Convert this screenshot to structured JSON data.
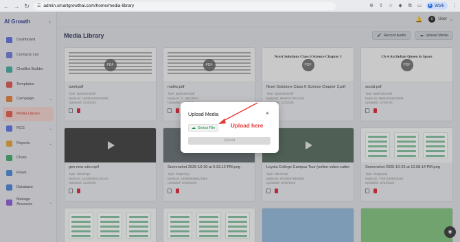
{
  "browser": {
    "url": "admin.smartgrowthai.com/home/media-library",
    "profile_label": "Work",
    "profile_initial": "D"
  },
  "sidebar": {
    "brand": "AI Growth",
    "items": [
      {
        "label": "Dashboard",
        "icon": "dashboard-icon",
        "color": "#5b6ee1"
      },
      {
        "label": "Contacts List",
        "icon": "contacts-icon",
        "color": "#6a7bd6"
      },
      {
        "label": "ChatBot Builder",
        "icon": "chatbot-icon",
        "color": "#3fa7a0"
      },
      {
        "label": "Templates",
        "icon": "templates-icon",
        "color": "#d9534f"
      },
      {
        "label": "Campaign",
        "icon": "campaign-icon",
        "color": "#e07b39",
        "caret": "⌄"
      },
      {
        "label": "Media Library",
        "icon": "media-icon",
        "color": "#e05a4a",
        "active": true
      },
      {
        "label": "RCS",
        "icon": "rcs-icon",
        "color": "#5b6ee1",
        "caret": "⌄"
      },
      {
        "label": "Reports",
        "icon": "reports-icon",
        "color": "#e0a23a",
        "caret": "⌄"
      },
      {
        "label": "Chats",
        "icon": "chats-icon",
        "color": "#3fa76a"
      },
      {
        "label": "Flows",
        "icon": "flows-icon",
        "color": "#4a86d6"
      },
      {
        "label": "Database",
        "icon": "database-icon",
        "color": "#4a7fd6"
      },
      {
        "label": "Manage Accounts",
        "icon": "accounts-icon",
        "color": "#8a5bd6",
        "caret": "⌄"
      }
    ]
  },
  "topbar": {
    "user_label": "User",
    "user_initial": "U"
  },
  "page": {
    "title": "Media Library",
    "record_audio": "Record Audio",
    "upload_media": "Upload Media"
  },
  "labels": {
    "type": "Type:",
    "media_id": "Media ID:",
    "uploaded": "Uploaded:"
  },
  "cards": [
    {
      "name": "tamil.pdf",
      "type": "application/pdf",
      "media_id": "1180826485404089",
      "uploaded": "11/3/2025",
      "kind": "doc",
      "heading": ""
    },
    {
      "name": "maths.pdf",
      "type": "application/pdf",
      "media_id": "2…68749701",
      "uploaded": "11/3/2025",
      "kind": "doc",
      "heading": ""
    },
    {
      "name": "Ncert Solutions Class 6 Science Chapter 3.pdf",
      "type": "application/pdf",
      "media_id": "889904270012644",
      "uploaded": "11/3/2025",
      "kind": "doc",
      "heading": "Ncert Solutions Class 6 Science Chapter 3"
    },
    {
      "name": "social.pdf",
      "type": "application/pdf",
      "media_id": "868945489430809",
      "uploaded": "11/3/2025",
      "kind": "doc",
      "heading": "Ch 4 An Indian Queen in Space"
    },
    {
      "name": "gen new vdo.mp4",
      "type": "video/mp4",
      "media_id": "1143309000122441",
      "uploaded": "11/3/2025",
      "kind": "video",
      "variant": "v1"
    },
    {
      "name": "Screenshot 2025-10-30 at 5.33.12 PM.png",
      "type": "image/png",
      "media_id": "1559958896537569",
      "uploaded": "10/30/2025",
      "kind": "video",
      "variant": "v2"
    },
    {
      "name": "Loyola College Campus Tour (online-video-cutter.co…",
      "type": "video/mp4",
      "media_id": "676382978405963",
      "uploaded": "10/30/2025",
      "kind": "video",
      "variant": "v3"
    },
    {
      "name": "Screenshot 2025-10-23 at 12.58.14 PM.png",
      "type": "image/png",
      "media_id": "776671898422063",
      "uploaded": "10/23/2025",
      "kind": "shot"
    }
  ],
  "row3": [
    {
      "kind": "shot"
    },
    {
      "kind": "shot"
    },
    {
      "kind": "img"
    },
    {
      "kind": "img2"
    }
  ],
  "modal": {
    "title": "Upload Media",
    "close": "×",
    "select_file": "Select File",
    "upload": "Upload"
  },
  "annotation": {
    "text": "Upload here",
    "color": "#e53935"
  }
}
